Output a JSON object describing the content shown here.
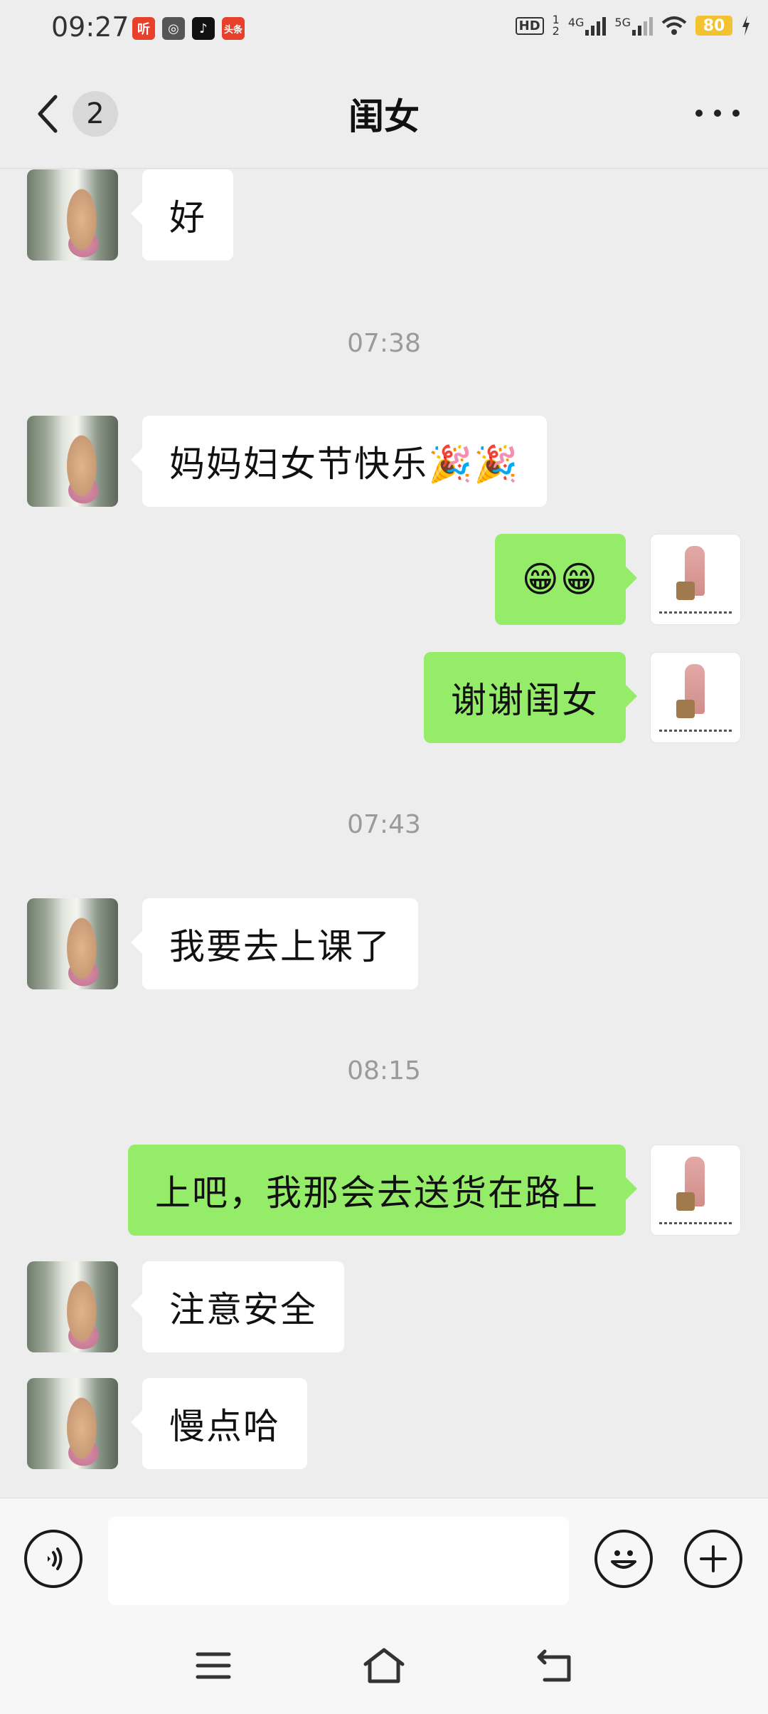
{
  "status_bar": {
    "time": "09:27",
    "apps": [
      {
        "name": "listen-app-icon",
        "glyph": "听",
        "color": "#e8402a"
      },
      {
        "name": "link-app-icon",
        "glyph": "◎",
        "color": "#555555"
      },
      {
        "name": "tiktok-app-icon",
        "glyph": "♪",
        "color": "#111111"
      },
      {
        "name": "toutiao-app-icon",
        "glyph": "头条",
        "color": "#e8402a"
      }
    ],
    "hd": "HD",
    "sim1": "1",
    "sim2": "2",
    "net1": "4G",
    "net2": "5G",
    "battery": "80"
  },
  "header": {
    "back_badge": "2",
    "title": "闺女"
  },
  "messages": [
    {
      "type": "in",
      "text": "好"
    },
    {
      "type": "time",
      "text": "07:38"
    },
    {
      "type": "in",
      "text": "妈妈妇女节快乐🎉🎉"
    },
    {
      "type": "out",
      "text": "😁😁"
    },
    {
      "type": "out",
      "text": "谢谢闺女"
    },
    {
      "type": "time",
      "text": "07:43"
    },
    {
      "type": "in",
      "text": "我要去上课了"
    },
    {
      "type": "time",
      "text": "08:15"
    },
    {
      "type": "out",
      "text": "上吧，我那会去送货在路上"
    },
    {
      "type": "in",
      "text": "注意安全"
    },
    {
      "type": "in",
      "text": "慢点哈"
    }
  ],
  "input": {
    "value": "",
    "placeholder": ""
  }
}
